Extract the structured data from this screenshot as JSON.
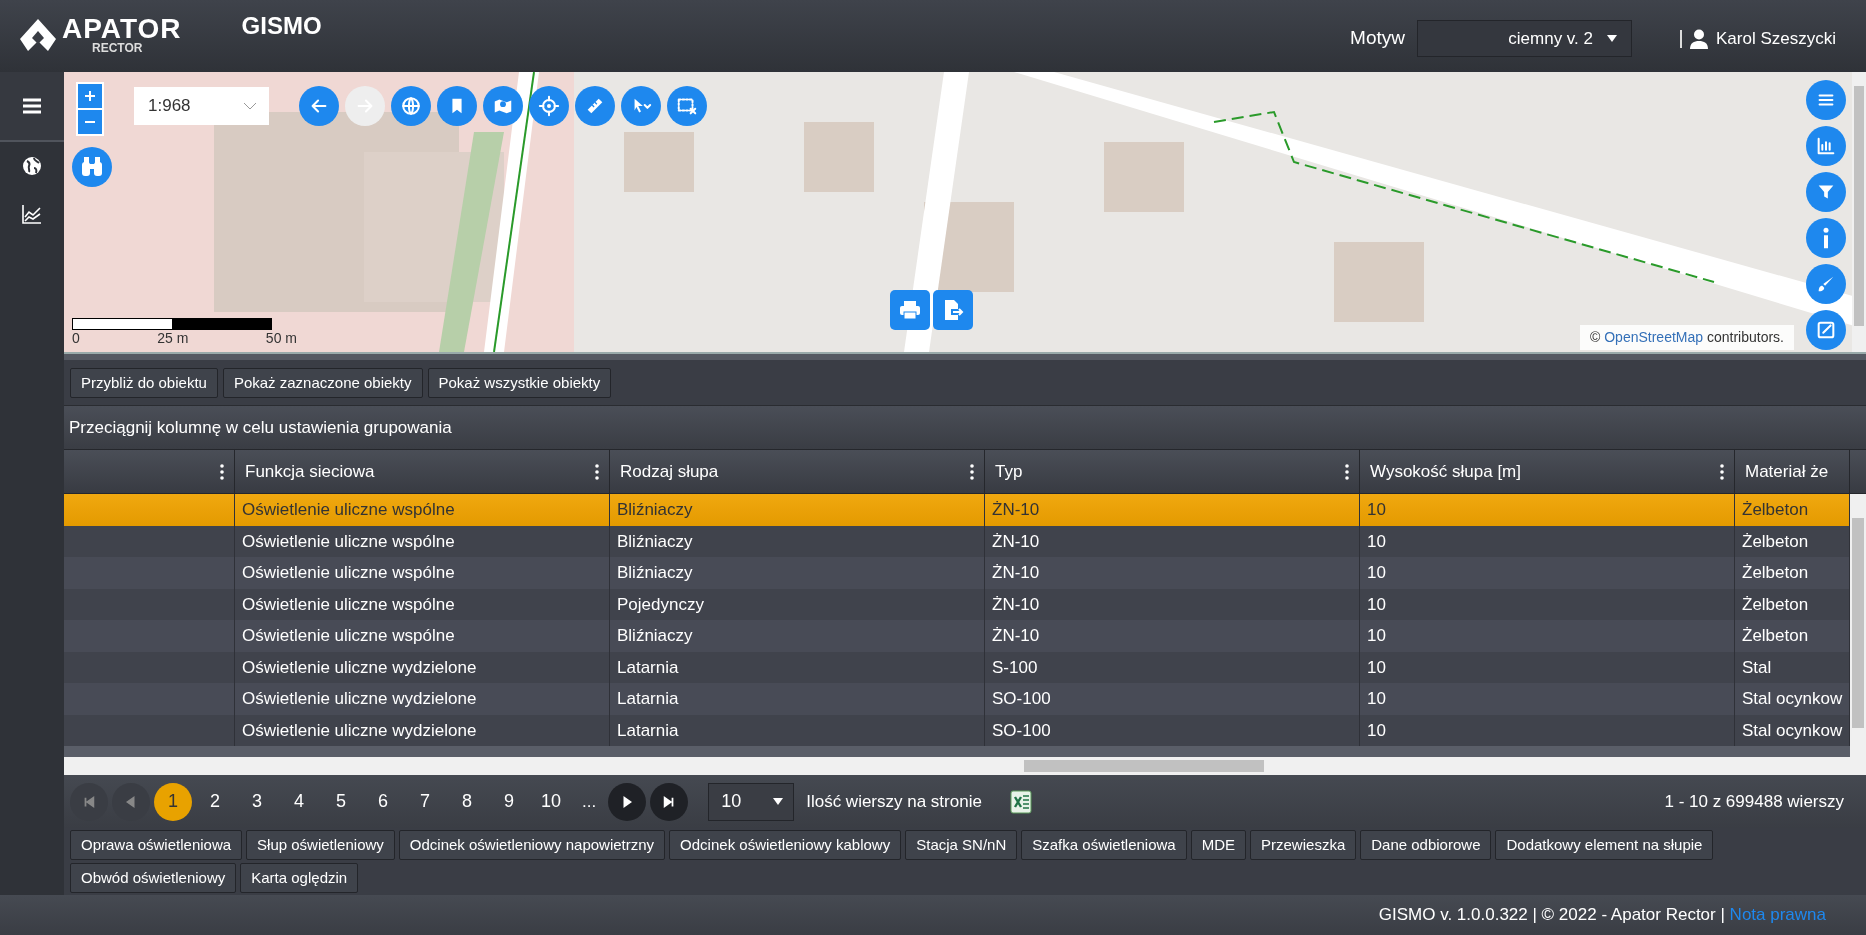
{
  "header": {
    "logo_name": "APATOR",
    "logo_sub": "RECTOR",
    "app_title": "GISMO",
    "theme_label": "Motyw",
    "theme_value": "ciemny v. 2",
    "user": "Karol Szeszycki"
  },
  "sidebar": {
    "items": [
      {
        "kind": "menu",
        "selected": true
      },
      {
        "kind": "globe",
        "selected": false
      },
      {
        "kind": "chart",
        "selected": false
      }
    ]
  },
  "map": {
    "scale_value": "1:968",
    "tools": [
      {
        "kind": "back",
        "disabled": false
      },
      {
        "kind": "forward",
        "disabled": true
      },
      {
        "kind": "globe",
        "disabled": false
      },
      {
        "kind": "bookmark",
        "disabled": false
      },
      {
        "kind": "map",
        "disabled": false
      },
      {
        "kind": "target",
        "disabled": false
      },
      {
        "kind": "ruler",
        "disabled": false
      },
      {
        "kind": "select",
        "disabled": false
      },
      {
        "kind": "clear",
        "disabled": false
      }
    ],
    "side_tools": [
      {
        "kind": "layers"
      },
      {
        "kind": "chart"
      },
      {
        "kind": "filter"
      },
      {
        "kind": "info"
      },
      {
        "kind": "brush"
      },
      {
        "kind": "edit"
      }
    ],
    "scalebar_labels": [
      "0",
      "25 m",
      "50 m"
    ],
    "attribution_prefix": "©",
    "attribution_link": "OpenStreetMap",
    "attribution_text": "contributors."
  },
  "actions": [
    "Przybliż do obiektu",
    "Pokaż zaznaczone obiekty",
    "Pokaż wszystkie obiekty"
  ],
  "group_hint": "Przeciągnij kolumnę w celu ustawienia grupowania",
  "table": {
    "columns": [
      "Funkcja sieciowa",
      "Rodzaj słupa",
      "Typ",
      "Wysokość słupa [m]",
      "Materiał że"
    ],
    "rows": [
      {
        "selected": true,
        "cells": [
          "Oświetlenie uliczne wspólne",
          "Bliźniaczy",
          "ŻN-10",
          "10",
          "Żelbeton"
        ]
      },
      {
        "selected": false,
        "cells": [
          "Oświetlenie uliczne wspólne",
          "Bliźniaczy",
          "ŻN-10",
          "10",
          "Żelbeton"
        ]
      },
      {
        "selected": false,
        "cells": [
          "Oświetlenie uliczne wspólne",
          "Bliźniaczy",
          "ŻN-10",
          "10",
          "Żelbeton"
        ]
      },
      {
        "selected": false,
        "cells": [
          "Oświetlenie uliczne wspólne",
          "Pojedynczy",
          "ŻN-10",
          "10",
          "Żelbeton"
        ]
      },
      {
        "selected": false,
        "cells": [
          "Oświetlenie uliczne wspólne",
          "Bliźniaczy",
          "ŻN-10",
          "10",
          "Żelbeton"
        ]
      },
      {
        "selected": false,
        "cells": [
          "Oświetlenie uliczne wydzielone",
          "Latarnia",
          "S-100",
          "10",
          "Stal"
        ]
      },
      {
        "selected": false,
        "cells": [
          "Oświetlenie uliczne wydzielone",
          "Latarnia",
          "SO-100",
          "10",
          "Stal ocynkow"
        ]
      },
      {
        "selected": false,
        "cells": [
          "Oświetlenie uliczne wydzielone",
          "Latarnia",
          "SO-100",
          "10",
          "Stal ocynkow"
        ]
      }
    ]
  },
  "pager": {
    "nav": [
      {
        "kind": "first",
        "disabled": true
      },
      {
        "kind": "prev",
        "disabled": true
      },
      {
        "kind": "next",
        "disabled": false
      },
      {
        "kind": "last",
        "disabled": false
      }
    ],
    "pages": [
      {
        "label": "1",
        "selected": true
      },
      {
        "label": "2",
        "selected": false
      },
      {
        "label": "3",
        "selected": false
      },
      {
        "label": "4",
        "selected": false
      },
      {
        "label": "5",
        "selected": false
      },
      {
        "label": "6",
        "selected": false
      },
      {
        "label": "7",
        "selected": false
      },
      {
        "label": "8",
        "selected": false
      },
      {
        "label": "9",
        "selected": false
      },
      {
        "label": "10",
        "selected": false
      }
    ],
    "ellipsis": "...",
    "page_size": "10",
    "page_size_label": "Ilość wierszy na stronie",
    "summary": "1 - 10 z 699488 wierszy"
  },
  "layer_buttons": [
    "Oprawa oświetleniowa",
    "Słup oświetleniowy",
    "Odcinek oświetleniowy napowietrzny",
    "Odcinek oświetleniowy kablowy",
    "Stacja SN/nN",
    "Szafka oświetleniowa",
    "MDE",
    "Przewieszka",
    "Dane odbiorowe",
    "Dodatkowy element na słupie",
    "Obwód oświetleniowy",
    "Karta oględzin"
  ],
  "footer": {
    "text": "GISMO v. 1.0.0.322 | © 2022 - Apator Rector |",
    "link": "Nota prawna"
  }
}
